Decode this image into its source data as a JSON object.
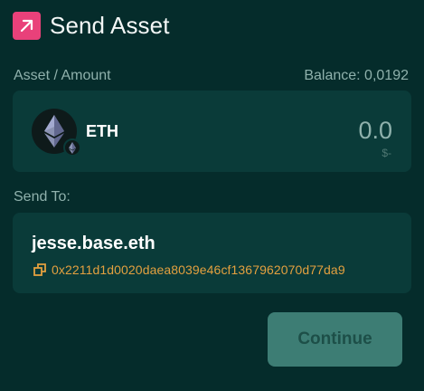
{
  "header": {
    "title": "Send Asset",
    "icon": "arrow-up-right-icon",
    "icon_bg": "#e9417a"
  },
  "asset_section": {
    "label": "Asset / Amount",
    "balance": "Balance: 0,0192"
  },
  "asset": {
    "symbol": "ETH",
    "icon": "ethereum-icon",
    "network_icon": "ethereum-network-icon",
    "amount": "0.0",
    "fiat": "$-"
  },
  "send_to": {
    "label": "Send To:",
    "name": "jesse.base.eth",
    "address": "0x2211d1d0020daea8039e46cf1367962070d77da9",
    "address_icon": "copy-icon",
    "address_color": "#e3a03f"
  },
  "actions": {
    "continue_label": "Continue"
  }
}
